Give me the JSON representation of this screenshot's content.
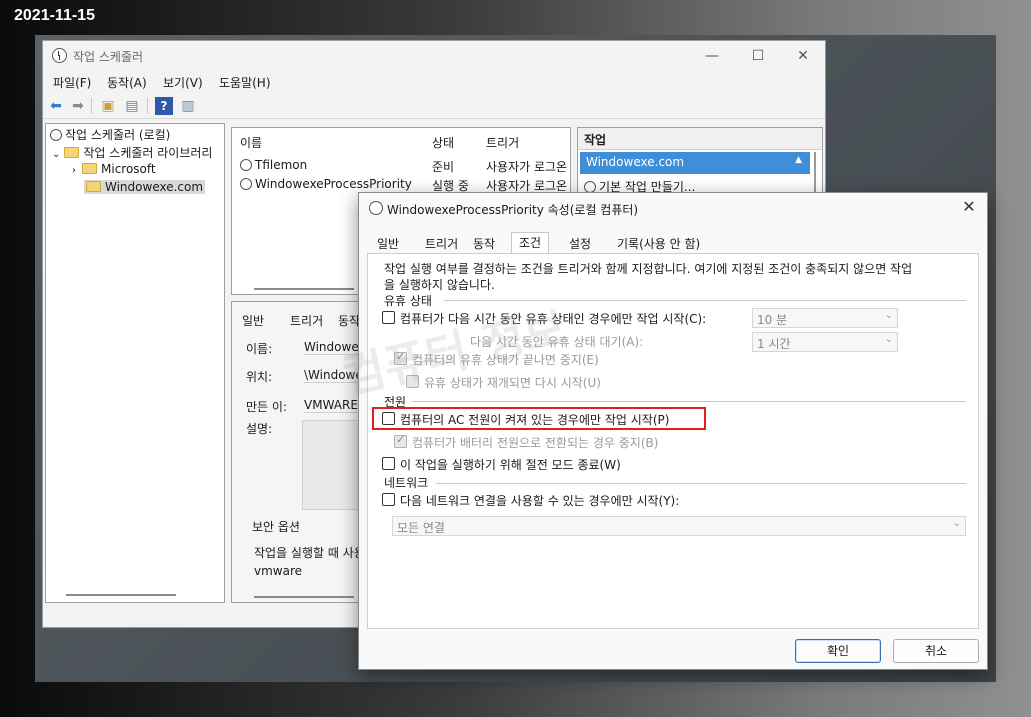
{
  "date_stamp": "2021-11-15",
  "main_window": {
    "title": "작업 스케줄러",
    "controls": {
      "minimize": "—",
      "maximize": "☐",
      "close": "✕"
    },
    "menu": [
      "파일(F)",
      "동작(A)",
      "보기(V)",
      "도움말(H)"
    ],
    "tree": {
      "root": "작업 스케줄러 (로컬)",
      "library": "작업 스케줄러 라이브러리",
      "folders": [
        "Microsoft",
        "Windowexe.com"
      ]
    },
    "task_list": {
      "columns": [
        "이름",
        "상태",
        "트리거"
      ],
      "rows": [
        {
          "name": "Tfilemon",
          "status": "준비",
          "trigger": "사용자가 로그온"
        },
        {
          "name": "WindowexeProcessPriority",
          "status": "실행 중",
          "trigger": "사용자가 로그온"
        }
      ]
    },
    "detail": {
      "tabs": [
        "일반",
        "트리거",
        "동작"
      ],
      "labels": {
        "name": "이름:",
        "location": "위치:",
        "author": "만든 이:",
        "description": "설명:"
      },
      "values": {
        "name": "WindowexeProcessPriority",
        "location": "\\WindowexeProcessPriority",
        "author": "VMWARE\\vmware"
      },
      "security_title": "보안 옵션",
      "security_text": "작업을 실행할 때 사용할 사용자 계정:",
      "security_user": "vmware"
    },
    "actions": {
      "header": "작업",
      "selected": "Windowexe.com",
      "item": "기본 작업 만들기..."
    }
  },
  "dialog": {
    "title": "WindowexeProcessPriority 속성(로컬 컴퓨터)",
    "close": "✕",
    "tabs": [
      "일반",
      "트리거",
      "동작",
      "조건",
      "설정",
      "기록(사용 안 함)"
    ],
    "active_tab": "조건",
    "intro_line1": "작업 실행 여부를 결정하는 조건을 트리거와 함께 지정합니다. 여기에 지정된 조건이 충족되지 않으면 작업",
    "intro_line2": "을 실행하지 않습니다.",
    "idle": {
      "title": "유휴 상태",
      "start_only_idle": "컴퓨터가 다음 시간 동안 유휴 상태인 경우에만 작업 시작(C):",
      "idle_duration": "10 분",
      "wait_label": "다음 시간 동안 유휴 상태 대기(A):",
      "wait_duration": "1 시간",
      "stop_on_end": "컴퓨터의 유휴 상태가 끝나면 중지(E)",
      "restart_on_resume": "유휴 상태가 재개되면 다시 시작(U)"
    },
    "power": {
      "title": "전원",
      "ac_only": "컴퓨터의 AC 전원이 켜져 있는 경우에만 작업 시작(P)",
      "stop_on_battery": "컴퓨터가 배터리 전원으로 전환되는 경우 중지(B)",
      "wake": "이 작업을 실행하기 위해 절전 모드 종료(W)"
    },
    "network": {
      "title": "네트워크",
      "start_only_network": "다음 네트워크 연결을 사용할 수 있는 경우에만 시작(Y):",
      "connection": "모든 연결"
    },
    "ok": "확인",
    "cancel": "취소"
  },
  "watermark": "컴퓨터 정보",
  "colors": {
    "selection_blue": "#3f8fd8",
    "highlight_red": "#e02020"
  }
}
